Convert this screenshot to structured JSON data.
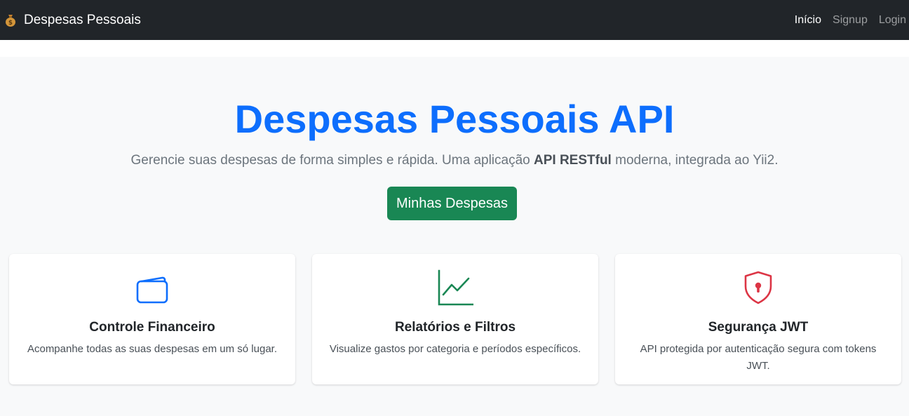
{
  "nav": {
    "brand_label": "Despesas Pessoais",
    "brand_icon": "money-bag-icon",
    "links": [
      {
        "label": "Início",
        "active": true
      },
      {
        "label": "Signup",
        "active": false
      },
      {
        "label": "Login",
        "active": false
      }
    ]
  },
  "hero": {
    "title": "Despesas Pessoais API",
    "lead_before": "Gerencie suas despesas de forma simples e rápida. Uma aplicação ",
    "lead_strong": "API RESTful",
    "lead_after": " moderna, integrada ao Yii2.",
    "button_label": "Minhas Despesas"
  },
  "features": [
    {
      "title": "Controle Financeiro",
      "text": "Acompanhe todas as suas despesas em um só lugar.",
      "icon": "wallet-icon",
      "color": "#0d6efd"
    },
    {
      "title": "Relatórios e Filtros",
      "text": "Visualize gastos por categoria e períodos específicos.",
      "icon": "graph-up-icon",
      "color": "#198754"
    },
    {
      "title": "Segurança JWT",
      "text": "API protegida por autenticação segura com tokens JWT.",
      "icon": "shield-lock-icon",
      "color": "#dc3545"
    }
  ],
  "colors": {
    "navbar_bg": "#212529",
    "primary": "#0d6efd",
    "success": "#198754",
    "danger": "#dc3545",
    "hero_bg": "#f8f9fa"
  }
}
